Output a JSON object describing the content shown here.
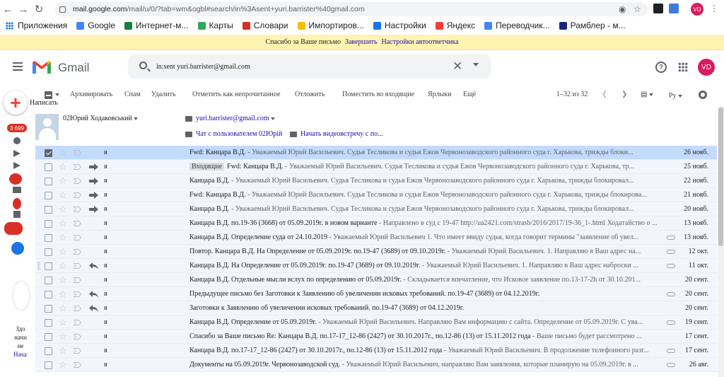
{
  "browser": {
    "url_host": "mail.google.com",
    "url_path": "/mail/u/0/?tab=wm&ogbl#search/in%3Asent+yuri.barrister%40gmail.com",
    "avatar_initials": "VD"
  },
  "bookmarks": [
    {
      "label": "Приложения",
      "color": "#1a73e8"
    },
    {
      "label": "Google",
      "color": "#4285f4"
    },
    {
      "label": "Интернет-м...",
      "color": "#188038"
    },
    {
      "label": "Карты",
      "color": "#34a853"
    },
    {
      "label": "Словари",
      "color": "#d93025"
    },
    {
      "label": "Импортиров...",
      "color": "#fbbc04"
    },
    {
      "label": "Настройки",
      "color": "#1a73e8"
    },
    {
      "label": "Яндекс",
      "color": "#ea4335"
    },
    {
      "label": "Переводчик...",
      "color": "#4285f4"
    },
    {
      "label": "Рамблер - м...",
      "color": "#1a237e"
    }
  ],
  "banner": {
    "text": "Спасибо за Ваше письмо",
    "link1": "Завершить",
    "link2": "Настройки автоответчика"
  },
  "gmail": {
    "logo_text": "Gmail",
    "search_value": "in:sent yuri.barrister@gmail.com",
    "account_initials": "VD",
    "compose_label": "Написать",
    "inbox_count": "3 699"
  },
  "toolbar": {
    "archive": "Архивировать",
    "spam": "Спам",
    "delete": "Удалить",
    "mark_unread": "Отметить как непрочитанное",
    "snooze": "Отложить",
    "move_inbox": "Поместить во входящие",
    "labels": "Ярлыки",
    "more": "Ещё",
    "range": "1–32 из 32",
    "lang": "Ру"
  },
  "contact": {
    "name": "02Юрий Ходаковський",
    "email": "yuri.barrister@gmail.com",
    "chat": "Чат с пользователем 02Юрій",
    "video": "Начать видеовстречу с по..."
  },
  "sidebar_text": {
    "line1": "Здо",
    "line2": "начн",
    "line3": "не",
    "line4": "Начат"
  },
  "emails": [
    {
      "selected": true,
      "icon": "none",
      "sender": "я",
      "tag": "",
      "subject": "Fwd: Канцара В.Д.",
      "snippet": " - Уважаемый Юрий Васильевич. Судья Тесликова и судья Ежов Червонозаводского районного суда г. Харькова, трижды блоки...",
      "attach": false,
      "date": "26 нояб."
    },
    {
      "selected": false,
      "icon": "forward",
      "sender": "я",
      "tag": "Входящие",
      "subject": "Fwd: Канцара В.Д.",
      "snippet": " - Уважаемый Юрий Васильевич. Судья Тесликова и судья Ежов Червонозаводского районного суда г. Харькова, тр...",
      "attach": false,
      "date": "25 нояб."
    },
    {
      "selected": false,
      "icon": "forward",
      "sender": "я",
      "tag": "",
      "subject": "Канцара В.Д.",
      "snippet": " - Уважаемый Юрий Васильевич. Судья Тесликова и судья Ежов Червонозаводского районного суда г. Харькова, трижды блокировал...",
      "attach": false,
      "date": "22 нояб."
    },
    {
      "selected": false,
      "icon": "forward",
      "sender": "я",
      "tag": "",
      "subject": "Fwd: Канцара В.Д.",
      "snippet": " - Уважаемый Юрий Васильевич. Судья Тесликова и судья Ежов Червонозаводского районного суда г. Харькова, трижды блокирова...",
      "attach": false,
      "date": "21 нояб."
    },
    {
      "selected": false,
      "icon": "forward",
      "sender": "я",
      "tag": "",
      "subject": "Канцара В.Д.",
      "snippet": " - Уважаемый Юрий Васильевич. Судья Тесликова и судья Ежов Червонозаводского районного суда г. Харькова, трижды блокировал...",
      "attach": false,
      "date": "20 нояб."
    },
    {
      "selected": false,
      "icon": "none",
      "sender": "я",
      "tag": "",
      "subject": "Канцара В.Д. по.19-36 (3668) от 05.09.2019г. в новом варианте",
      "snippet": " - Направлено в суд с 19-47 http://ua2421.com/strasb/2016/2017/19-36_1-.html Ходатайство о ...",
      "attach": false,
      "date": "13 нояб."
    },
    {
      "selected": false,
      "icon": "none",
      "sender": "я",
      "tag": "",
      "subject": "Канцара В.Д. Определение суда от 24.10.2019",
      "snippet": " - Уважаемый Юрий Васильевич 1. Что имеет ввиду судья, когда говорит термины \"заявление об увел...",
      "attach": true,
      "date": "13 нояб."
    },
    {
      "selected": false,
      "icon": "none",
      "sender": "я",
      "tag": "",
      "subject": "Повтор. Канцара В.Д. На Определение от 05.09.2019г. по.19-47 (3689) от 09.10.2019г.",
      "snippet": " - Уважаемый Юрий Васильевич. 1. Направляю в Ваш адрес на...",
      "attach": true,
      "date": "12 окт."
    },
    {
      "selected": false,
      "icon": "reply",
      "sender": "я",
      "tag": "",
      "subject": "Канцара В.Д. На Определение от 05.09.2019г. по.19-47 (3689) от 09.10.2019г.",
      "snippet": " - Уважаемый Юрий Васильевич. 1. Направляю в Ваш адрес наброски ...",
      "attach": true,
      "date": "11 окт."
    },
    {
      "selected": false,
      "icon": "none",
      "sender": "я",
      "tag": "",
      "subject": "Канцара В.Д. Отдельные мысли вслух по определению от 05.09.2019г.",
      "snippet": " - Складывается впечатление, что Исковое заявление по.13-17-2h от 30.10.201...",
      "attach": false,
      "date": "20 сент."
    },
    {
      "selected": false,
      "icon": "reply",
      "sender": "я",
      "tag": "",
      "subject": "Предыдущее письмо без Заготовки к Заявлению об увеличении исковых требований. по.19-47 (3689) от 04.12.2019г.",
      "snippet": "",
      "attach": true,
      "date": "20 сент."
    },
    {
      "selected": false,
      "icon": "reply",
      "sender": "я",
      "tag": "",
      "subject": "Заготовки к Заявлению об увеличении исковых требований. по.19-47 (3689) от 04.12.2019г.",
      "snippet": "",
      "attach": false,
      "date": "20 сент."
    },
    {
      "selected": false,
      "icon": "none",
      "sender": "я",
      "tag": "",
      "subject": "Канцара В.Д. Определение от 05.09.2019г.",
      "snippet": " - Уважаемый Юрий Васильевич. Направляю Вам информацию с сайта. Определение от 05.09.2019г. С ува...",
      "attach": true,
      "date": "19 сент."
    },
    {
      "selected": false,
      "icon": "none",
      "sender": "я",
      "tag": "",
      "subject": "Спасибо за Ваше письмо Re: Канцара В.Д. по.17-17_12-86 (2427) от 30.10.2017г., по.12-86 (13) от 15.11.2012 года",
      "snippet": " - Ваше письмо будет рассмотрено ...",
      "attach": false,
      "date": "17 сент."
    },
    {
      "selected": false,
      "icon": "none",
      "sender": "я",
      "tag": "",
      "subject": "Канцара В.Д. по.17-17_12-86 (2427) от 30.10.2017г., по.12-86 (13) от 15.11.2012 года",
      "snippet": " - Уважаемый Юрий Васильевич. В продолжение телефонного разг...",
      "attach": true,
      "date": "17 сент."
    },
    {
      "selected": false,
      "icon": "none",
      "sender": "я",
      "tag": "",
      "subject": "Документы на 05.09.2019г. Червонозаводской суд.",
      "snippet": " - Уважаемый Юрий Васильевич, направляю Вам заявления, которые планирую на 05.09.2019г. в ...",
      "attach": true,
      "date": "26 авг."
    }
  ]
}
